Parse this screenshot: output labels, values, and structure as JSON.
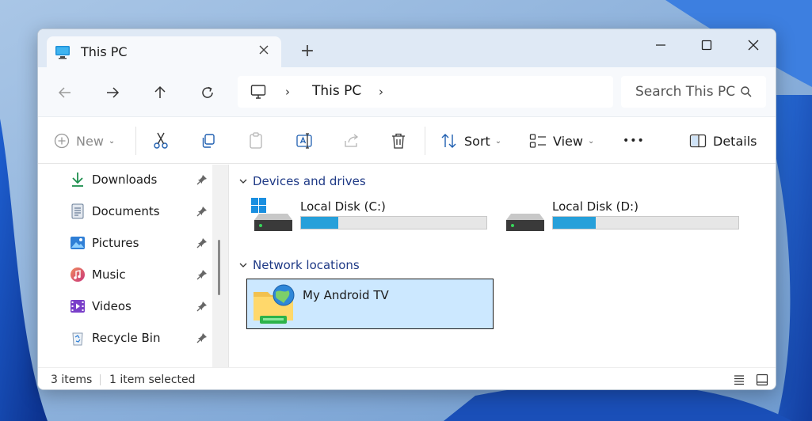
{
  "window": {
    "tab_title": "This PC",
    "new_tab_symbol": "+"
  },
  "icons": {
    "close": "close-icon",
    "minimize": "minimize-icon",
    "maximize": "maximize-icon",
    "back": "arrow-left-icon",
    "forward": "arrow-right-icon",
    "up": "arrow-up-icon",
    "refresh": "refresh-icon",
    "search": "search-icon"
  },
  "address": {
    "crumb": "This PC",
    "chevron": "›"
  },
  "search": {
    "placeholder": "Search This PC"
  },
  "toolbar": {
    "new_label": "New",
    "sort_label": "Sort",
    "view_label": "View",
    "more_label": "•••",
    "details_label": "Details",
    "caret": "⌄"
  },
  "sidebar": {
    "items": [
      {
        "label": "Downloads",
        "icon": "download-icon"
      },
      {
        "label": "Documents",
        "icon": "document-icon"
      },
      {
        "label": "Pictures",
        "icon": "picture-icon"
      },
      {
        "label": "Music",
        "icon": "music-icon"
      },
      {
        "label": "Videos",
        "icon": "video-icon"
      },
      {
        "label": "Recycle Bin",
        "icon": "recycle-bin-icon"
      }
    ]
  },
  "content": {
    "groups": {
      "drives": "Devices and drives",
      "network": "Network locations"
    },
    "drives": [
      {
        "name": "Local Disk (C:)",
        "used_fraction": 0.2
      },
      {
        "name": "Local Disk (D:)",
        "used_fraction": 0.23
      }
    ],
    "network_items": [
      {
        "name": "My Android TV",
        "selected": true
      }
    ]
  },
  "status": {
    "items_count": "3 items",
    "selected": "1 item selected"
  },
  "colors": {
    "accent": "#26a0da",
    "selection": "#cce8ff",
    "group_header": "#1f3a86"
  }
}
